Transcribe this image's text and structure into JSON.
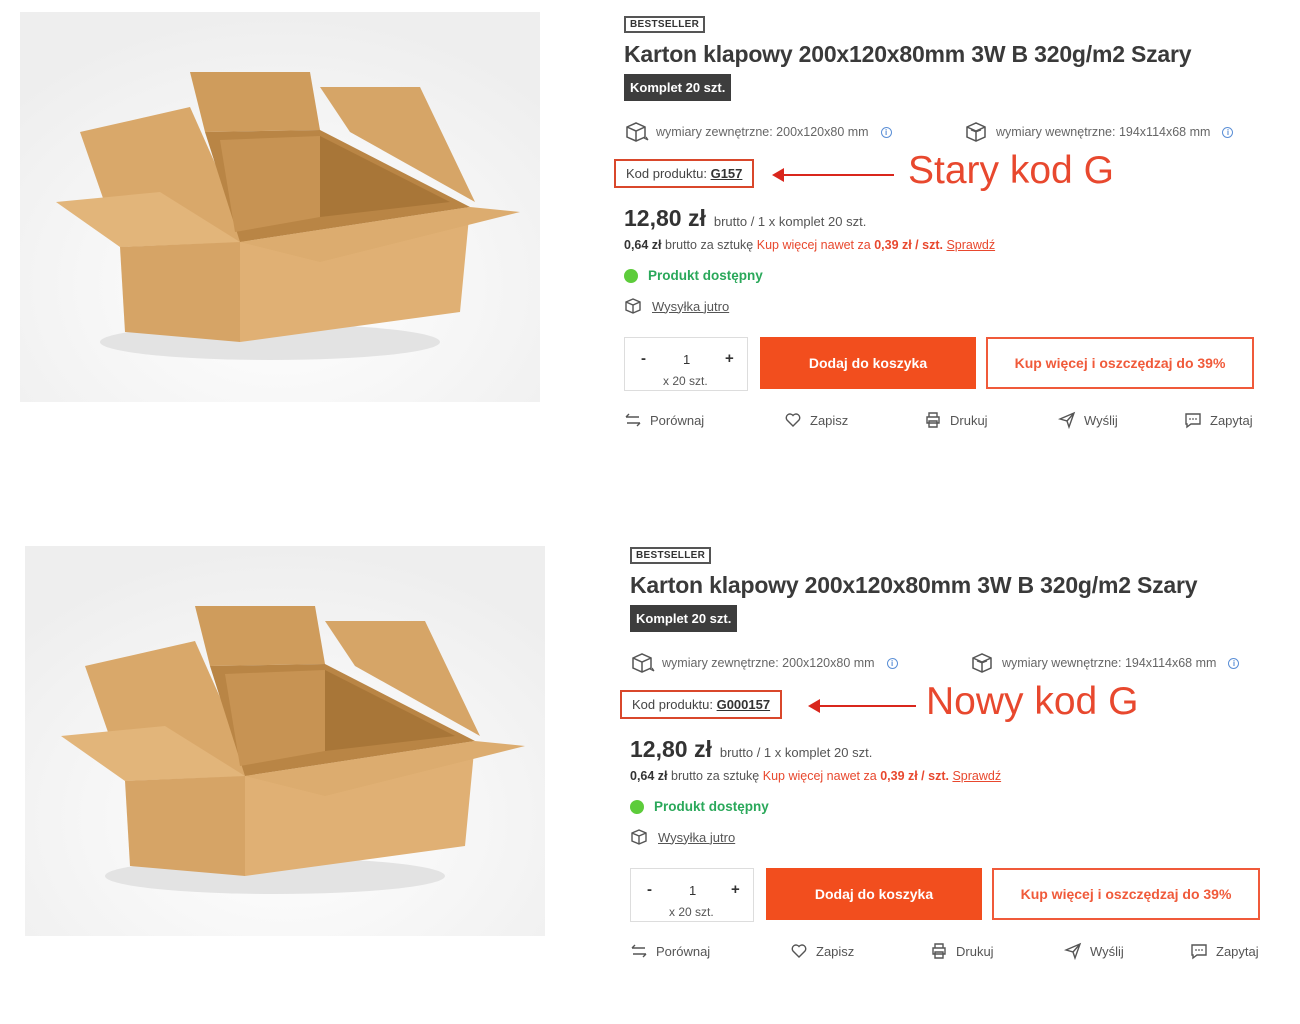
{
  "colors": {
    "accent": "#f24e1e",
    "annotation": "#e8482e",
    "available": "#2aa85a",
    "badge_dark": "#3d3d3d"
  },
  "panels": [
    {
      "badge": "BESTSELLER",
      "title": "Karton klapowy 200x120x80mm 3W B 320g/m2 Szary",
      "set_badge": "Komplet 20 szt.",
      "dim_outer": "wymiary zewnętrzne: 200x120x80 mm",
      "dim_inner": "wymiary wewnętrzne: 194x114x68 mm",
      "code_label": "Kod produktu:",
      "code_value": "G157",
      "annotation": "Stary kod G",
      "price": "12,80 zł",
      "price_note": "brutto / 1 x komplet 20 szt.",
      "unit_price": "0,64 zł",
      "unit_text": "brutto za sztukę",
      "promo_text": "Kup więcej nawet za",
      "promo_price": "0,39 zł / szt.",
      "check_link": "Sprawdź",
      "availability": "Produkt dostępny",
      "shipping": "Wysyłka jutro",
      "qty_minus": "-",
      "qty_value": "1",
      "qty_plus": "+",
      "qty_per": "x 20 szt.",
      "add_to_cart": "Dodaj do koszyka",
      "buy_more": "Kup więcej i oszczędzaj do 39%",
      "actions": [
        "Porównaj",
        "Zapisz",
        "Drukuj",
        "Wyślij",
        "Zapytaj"
      ]
    },
    {
      "badge": "BESTSELLER",
      "title": "Karton klapowy 200x120x80mm 3W B 320g/m2 Szary",
      "set_badge": "Komplet 20 szt.",
      "dim_outer": "wymiary zewnętrzne: 200x120x80 mm",
      "dim_inner": "wymiary wewnętrzne: 194x114x68 mm",
      "code_label": "Kod produktu:",
      "code_value": "G000157",
      "annotation": "Nowy kod G",
      "price": "12,80 zł",
      "price_note": "brutto / 1 x komplet 20 szt.",
      "unit_price": "0,64 zł",
      "unit_text": "brutto za sztukę",
      "promo_text": "Kup więcej nawet za",
      "promo_price": "0,39 zł / szt.",
      "check_link": "Sprawdź",
      "availability": "Produkt dostępny",
      "shipping": "Wysyłka jutro",
      "qty_minus": "-",
      "qty_value": "1",
      "qty_plus": "+",
      "qty_per": "x 20 szt.",
      "add_to_cart": "Dodaj do koszyka",
      "buy_more": "Kup więcej i oszczędzaj do 39%",
      "actions": [
        "Porównaj",
        "Zapisz",
        "Drukuj",
        "Wyślij",
        "Zapytaj"
      ]
    }
  ]
}
